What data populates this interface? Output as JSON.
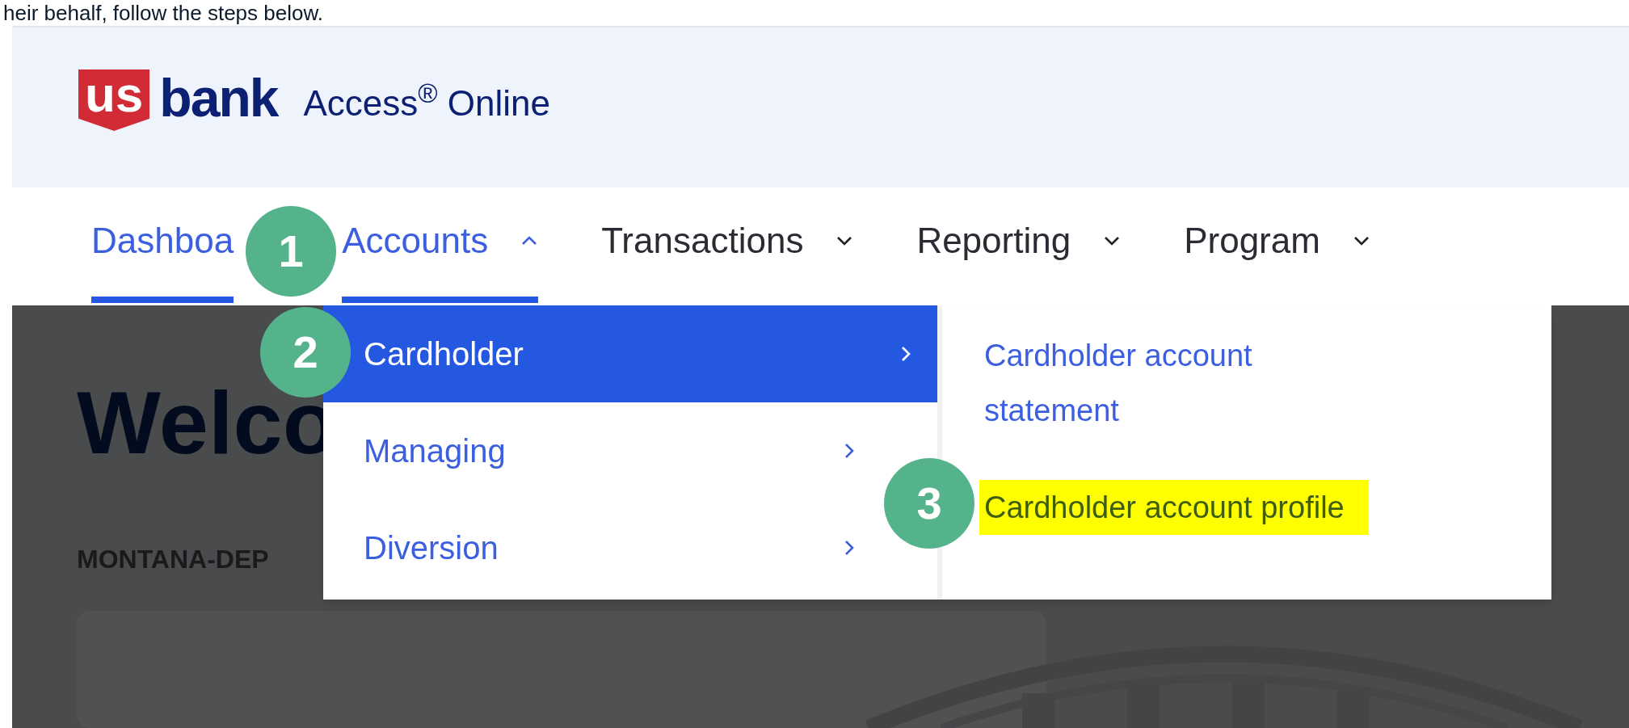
{
  "intro_text": "heir behalf, follow the steps below.",
  "header": {
    "logo_mark": "us",
    "logo_word": "bank",
    "product": "Access$^{®}$ Online"
  },
  "nav": [
    {
      "label": "Dashboa",
      "kind": "link",
      "selected": true
    },
    {
      "label": "Accounts",
      "kind": "menu",
      "selected": true,
      "expanded": true
    },
    {
      "label": "Transactions",
      "kind": "menu",
      "selected": false,
      "expanded": false
    },
    {
      "label": "Reporting",
      "kind": "menu",
      "selected": false,
      "expanded": false
    },
    {
      "label": "Program",
      "kind": "menu",
      "selected": false,
      "expanded": false
    }
  ],
  "page": {
    "title": "Welco",
    "org": "MONTANA-DEP"
  },
  "menu": {
    "items": [
      {
        "label": "Cardholder",
        "selected": true
      },
      {
        "label": "Managing",
        "selected": false
      },
      {
        "label": "Diversion",
        "selected": false
      }
    ],
    "submenu": [
      {
        "label": "Cardholder account statement",
        "highlighted": false
      },
      {
        "label": "Cardholder account profile",
        "highlighted": true
      }
    ]
  },
  "steps": [
    {
      "number": "1"
    },
    {
      "number": "2"
    },
    {
      "number": "3"
    }
  ]
}
